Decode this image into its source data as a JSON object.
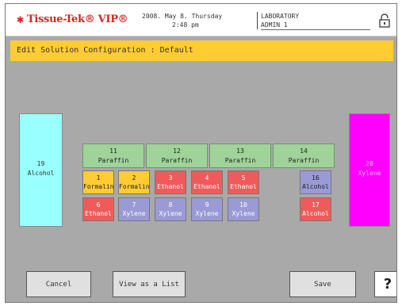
{
  "header": {
    "logo_text": "Tissue-Tek® VIP®",
    "date": "2008. May 8. Thursday",
    "time": "2:48 pm",
    "department": "LABORATORY",
    "user": "ADMIN 1",
    "icons": {
      "logo": "asterisk-logo-icon",
      "lock": "lock-icon"
    }
  },
  "title": "Edit Solution Configuration : Default",
  "stations": {
    "s19": {
      "num": "19",
      "label": "Alcohol"
    },
    "s20": {
      "num": "20",
      "label": "Xylene"
    },
    "s11": {
      "num": "11",
      "label": "Paraffin"
    },
    "s12": {
      "num": "12",
      "label": "Paraffin"
    },
    "s13": {
      "num": "13",
      "label": "Paraffin"
    },
    "s14": {
      "num": "14",
      "label": "Paraffin"
    },
    "s1": {
      "num": "1",
      "label": "Formalin"
    },
    "s2": {
      "num": "2",
      "label": "Formalin"
    },
    "s3": {
      "num": "3",
      "label": "Ethanol"
    },
    "s4": {
      "num": "4",
      "label": "Ethanol"
    },
    "s5": {
      "num": "5",
      "label": "Ethanol"
    },
    "s6": {
      "num": "6",
      "label": "Ethanol"
    },
    "s7": {
      "num": "7",
      "label": "Xylene"
    },
    "s8": {
      "num": "8",
      "label": "Xylene"
    },
    "s9": {
      "num": "9",
      "label": "Xylene"
    },
    "s10": {
      "num": "10",
      "label": "Xylene"
    },
    "s16": {
      "num": "16",
      "label": "Alcohol"
    },
    "s17": {
      "num": "17",
      "label": "Alcohol"
    }
  },
  "buttons": {
    "cancel": "Cancel",
    "view_list": "View as a List",
    "save": "Save",
    "help": "?"
  },
  "colors": {
    "title_bar": "#ffcc33",
    "formalin": "#ffcc33",
    "ethanol": "#f05a5a",
    "xylene": "#9a9ad6",
    "paraffin": "#9fd39a",
    "alcohol_reservoir": "#99ffff",
    "xylene_reservoir": "#ff00ff",
    "logo": "#d8231f"
  }
}
